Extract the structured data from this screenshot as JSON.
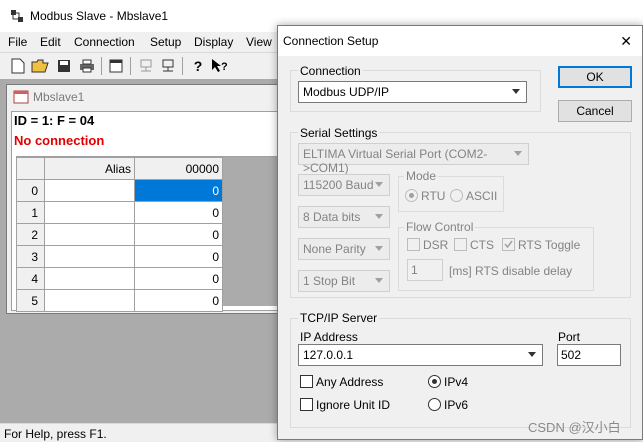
{
  "app": {
    "title": "Modbus Slave - Mbslave1",
    "menu": [
      "File",
      "Edit",
      "Connection",
      "Setup",
      "Display",
      "View"
    ],
    "status": "For Help, press F1."
  },
  "child": {
    "title": "Mbslave1",
    "id_line": "ID = 1: F = 04",
    "connection_status": "No connection",
    "columns": [
      "Alias",
      "00000"
    ],
    "rows": [
      {
        "index": "0",
        "alias": "",
        "value": "0"
      },
      {
        "index": "1",
        "alias": "",
        "value": "0"
      },
      {
        "index": "2",
        "alias": "",
        "value": "0"
      },
      {
        "index": "3",
        "alias": "",
        "value": "0"
      },
      {
        "index": "4",
        "alias": "",
        "value": "0"
      },
      {
        "index": "5",
        "alias": "",
        "value": "0"
      }
    ]
  },
  "dialog": {
    "title": "Connection Setup",
    "close_glyph": "✕",
    "ok_label": "OK",
    "cancel_label": "Cancel",
    "connection": {
      "label": "Connection",
      "value": "Modbus UDP/IP"
    },
    "serial": {
      "label": "Serial Settings",
      "port": "ELTIMA Virtual Serial Port (COM2->COM1)",
      "baud": "115200 Baud",
      "data_bits": "8 Data bits",
      "parity": "None Parity",
      "stop_bits": "1 Stop Bit",
      "mode_label": "Mode",
      "mode_rtu": "RTU",
      "mode_ascii": "ASCII",
      "flow_label": "Flow Control",
      "dsr": "DSR",
      "cts": "CTS",
      "rts_toggle": "RTS Toggle",
      "rts_delay_value": "1",
      "rts_delay_label": "[ms] RTS disable delay"
    },
    "tcp": {
      "label": "TCP/IP Server",
      "ip_label": "IP Address",
      "ip_value": "127.0.0.1",
      "port_label": "Port",
      "port_value": "502",
      "any_address": "Any Address",
      "ignore_unit_id": "Ignore Unit ID",
      "ipv4": "IPv4",
      "ipv6": "IPv6"
    }
  },
  "watermark": "CSDN @汉小白",
  "colors": {
    "selection": "#0078d7",
    "error": "#e00000"
  }
}
